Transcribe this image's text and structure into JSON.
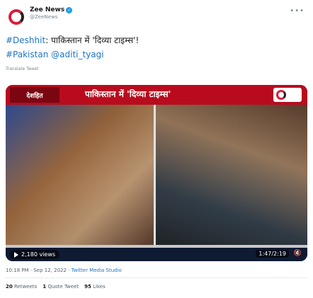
{
  "account": {
    "display_name": "Zee News",
    "handle": "@ZeeNews",
    "avatar_icon": "zee-news-logo-icon",
    "verified_icon": "verified-badge-icon",
    "more_icon": "more-options-icon"
  },
  "tweet": {
    "line1_hashtag": "#Deshhit",
    "line1_rest": ": पाकिस्तान में 'दिव्या टाइम्स'!",
    "line2_hashtag": "#Pakistan",
    "line2_mention": "@aditi_tyagi",
    "translate_label": "Translate Tweet"
  },
  "video": {
    "banner_logo_text": "देशहित",
    "banner_title": "पाकिस्तान में 'दिव्या टाइम्स'",
    "ticker_text": "",
    "views_label": "2,180 views",
    "time_code": "1:47/2:19",
    "play_icon": "play-icon",
    "mute_icon": "volume-icon"
  },
  "meta": {
    "time": "10:18 PM · Sep 12, 2022",
    "separator": " · ",
    "source": "Twitter Media Studio"
  },
  "stats": {
    "retweets_count": "20",
    "retweets_label": "Retweets",
    "quotes_count": "1",
    "quotes_label": "Quote Tweet",
    "likes_count": "95",
    "likes_label": "Likes"
  },
  "colors": {
    "link": "#1b74c4",
    "banner": "#b80c1e",
    "verified": "#1d9bf0"
  }
}
